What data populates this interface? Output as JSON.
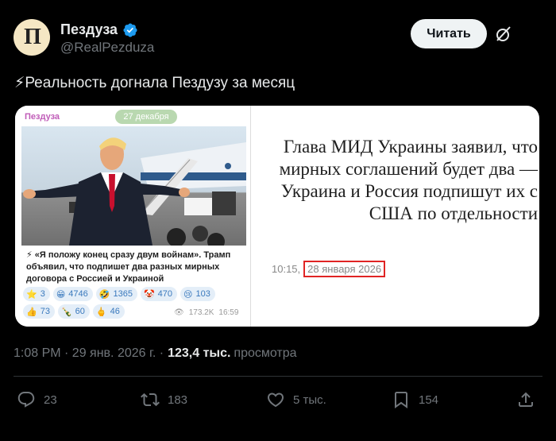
{
  "author": {
    "name": "Пездуза",
    "handle": "@RealPezduza",
    "avatar_letters": "П"
  },
  "follow_label": "Читать",
  "tweet_text": "⚡Реальность догнала Пездузу за месяц",
  "media": {
    "telegram": {
      "channel": "Пездуза",
      "date_chip": "27 декабря",
      "text": "⚡ «Я положу конец сразу двум войнам». Трамп объявил, что подпишет два разных мирных договора с Россией и Украиной",
      "reactions": [
        {
          "emoji": "⭐",
          "count": "3"
        },
        {
          "emoji": "😁",
          "count": "4746"
        },
        {
          "emoji": "🤣",
          "count": "1365"
        },
        {
          "emoji": "🤡",
          "count": "470"
        },
        {
          "emoji": "😢",
          "count": "103"
        },
        {
          "emoji": "👍",
          "count": "73"
        },
        {
          "emoji": "🍾",
          "count": "60"
        },
        {
          "emoji": "🖕",
          "count": "46"
        }
      ],
      "views": "173.2K",
      "time": "16:59"
    },
    "news": {
      "headline": "Глава МИД Украины заявил, что мирных соглашений будет два — Украина и Россия подпишут их с США по отдельности",
      "time": "10:15,",
      "date": "28 января 2026"
    }
  },
  "meta": {
    "time_date": "1:08 PM · 29 янв. 2026 г. ·",
    "views": "123,4 тыс.",
    "views_label": "просмотра"
  },
  "actions": {
    "replies": "23",
    "reposts": "183",
    "likes": "5 тыс.",
    "bookmarks": "154"
  },
  "colors": {
    "background": "#000000",
    "verified": "#1d9bf0",
    "highlight_box": "#e02424"
  }
}
